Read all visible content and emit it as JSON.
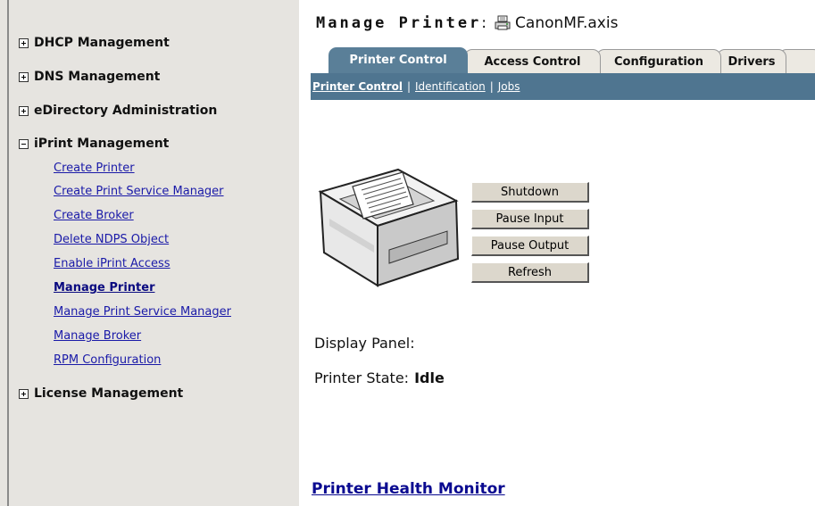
{
  "sidebar": {
    "categories": [
      {
        "label": "DHCP Management",
        "expanded": false
      },
      {
        "label": "DNS Management",
        "expanded": false
      },
      {
        "label": "eDirectory Administration",
        "expanded": false
      },
      {
        "label": "iPrint Management",
        "expanded": true
      },
      {
        "label": "License Management",
        "expanded": false
      }
    ],
    "iprint_tasks": [
      "Create Printer",
      "Create Print Service Manager",
      "Create Broker",
      "Delete NDPS Object",
      "Enable iPrint Access",
      "Manage Printer",
      "Manage Print Service Manager",
      "Manage Broker",
      "RPM Configuration"
    ],
    "current_task": "Manage Printer"
  },
  "header": {
    "title_prefix": "Manage Printer",
    "title_colon": ":",
    "printer_name": "CanonMF.axis",
    "printer_icon": "printer-icon"
  },
  "tabs": [
    {
      "label": "Printer Control",
      "active": true
    },
    {
      "label": "Access Control",
      "active": false
    },
    {
      "label": "Configuration",
      "active": false
    },
    {
      "label": "Drivers",
      "active": false
    }
  ],
  "subnav": {
    "items": [
      "Printer Control",
      "Identification",
      "Jobs"
    ],
    "separator": "|",
    "current": "Printer Control"
  },
  "controls": {
    "shutdown": "Shutdown",
    "pause_input": "Pause Input",
    "pause_output": "Pause Output",
    "refresh": "Refresh"
  },
  "status": {
    "display_panel_label": "Display Panel:",
    "printer_state_label": "Printer State:",
    "printer_state_value": "Idle"
  },
  "health_link": "Printer Health Monitor",
  "colors": {
    "sidebar_bg": "#e6e4e0",
    "tab_active": "#5a7f98",
    "subnav_bg": "#4f7590",
    "link": "#1a1aa8"
  }
}
